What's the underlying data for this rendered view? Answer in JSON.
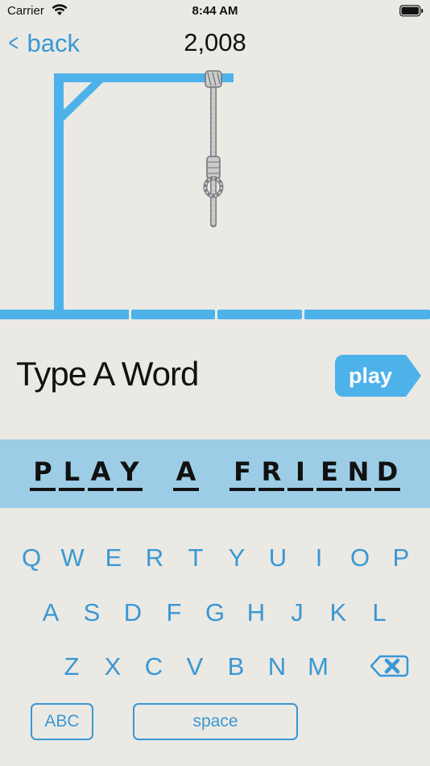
{
  "status_bar": {
    "carrier": "Carrier",
    "time": "8:44 AM"
  },
  "nav": {
    "back_label": "back",
    "score": "2,008"
  },
  "prompt": {
    "text": "Type A Word",
    "play_label": "play"
  },
  "word": {
    "words": [
      [
        "P",
        "L",
        "A",
        "Y"
      ],
      [
        "A"
      ],
      [
        "F",
        "R",
        "I",
        "E",
        "N",
        "D"
      ]
    ]
  },
  "keyboard": {
    "row1": [
      "Q",
      "W",
      "E",
      "R",
      "T",
      "Y",
      "U",
      "I",
      "O",
      "P"
    ],
    "row2": [
      "A",
      "S",
      "D",
      "F",
      "G",
      "H",
      "J",
      "K",
      "L"
    ],
    "row3": [
      "Z",
      "X",
      "C",
      "V",
      "B",
      "N",
      "M"
    ],
    "abc_label": "ABC",
    "space_label": "space"
  },
  "colors": {
    "accent": "#3a98d4",
    "gallows": "#4db2ea",
    "band": "#9dcde6",
    "background": "#ebe9e4"
  }
}
